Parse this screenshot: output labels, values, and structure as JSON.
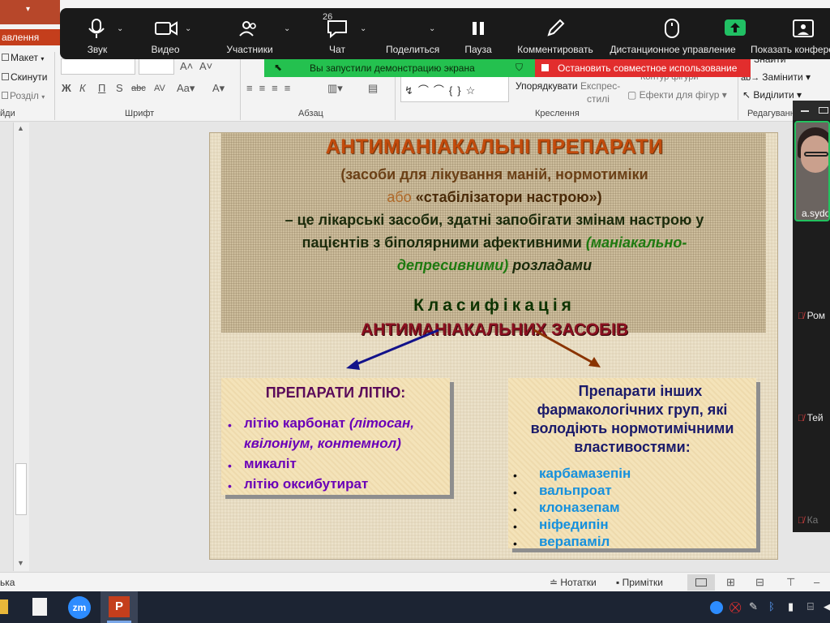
{
  "ribbon": {
    "home_tab": "авлення",
    "layout_btn": "Макет",
    "reset_btn": "Скинути",
    "section_btn": "Розділ",
    "font_group": "Шрифт",
    "paragraph_group": "Абзац",
    "drawing_group": "Креслення",
    "editing_group": "Редагування",
    "slides_group": "йди",
    "arrange_btn": "Упорядкувати",
    "quick_styles_btn1": "Експрес-",
    "quick_styles_btn2": "стилі",
    "shape_outline": "Контур фігури",
    "shape_effects": "Ефекти для фігур",
    "find_btn": "Знайти",
    "replace_btn": "Замінити",
    "select_btn": "Виділити"
  },
  "zoom": {
    "audio": "Звук",
    "video": "Видео",
    "participants": "Участники",
    "participants_count": "26",
    "chat": "Чат",
    "share": "Поделиться",
    "pause": "Пауза",
    "annotate": "Комментировать",
    "remote_control": "Дистанционное управление",
    "show_conference": "Показать конфере",
    "banner_text": "Вы запустили демонстрацию экрана",
    "stop_share": "Остановить совместное использование"
  },
  "slide": {
    "title": "АНТИМАНІАКАЛЬНІ  ПРЕПАРАТИ",
    "sub1": "(засоби для лікування маній,  нормотиміки",
    "sub2_a": "або",
    "sub2_b": " «стабілізатори настрою»)",
    "def1": "– це лікарські засоби, здатні запобігати змінам настрою у",
    "def2_a": "пацієнтів з біполярними афективними ",
    "def2_b": "(маніакально-",
    "def3_a": "депресивними)",
    "def3_b": " розладами",
    "class_label": "Класифікація",
    "class_sub": "АНТИМАНІАКАЛЬНИХ  ЗАСОБІВ",
    "lith_title": "ПРЕПАРАТИ   ЛІТІЮ:",
    "lith_items": [
      {
        "text": "літію карбонат ",
        "note": "(літосан,"
      },
      {
        "text": "",
        "note": "квілоніум, контемнол)"
      },
      {
        "text": "микаліт",
        "note": ""
      },
      {
        "text": "літію оксибутират",
        "note": ""
      }
    ],
    "other_title1": "Препарати інших",
    "other_title2": "фармакологічних груп, які",
    "other_title3": "володіють нормотимічними",
    "other_title4": "властивостями:",
    "other_items": [
      "карбамазепін",
      "вальпроат",
      "клоназепам",
      "ніфедипін",
      "верапаміл"
    ]
  },
  "video_panel": {
    "self_name": "a.sydo",
    "participants": [
      "Ром",
      "Тей",
      "Ка"
    ]
  },
  "status": {
    "language": "ька",
    "notes": "Нотатки",
    "comments": "Примітки"
  },
  "taskbar": {
    "zoom_icon_text": "zm",
    "ppt_icon_text": "P"
  },
  "colors": {
    "ppt_accent": "#c43e1c",
    "zoom_bar": "#1a1a1a",
    "share_green": "#24c14f",
    "stop_red": "#e22d2d"
  }
}
